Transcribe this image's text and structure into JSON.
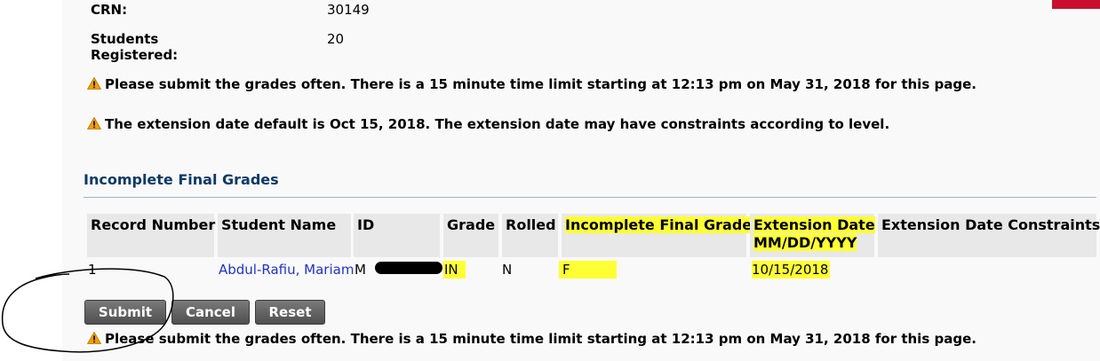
{
  "course_info": {
    "crn_label": "CRN:",
    "crn_value": "30149",
    "students_label": "Students Registered:",
    "students_value": "20"
  },
  "notices": {
    "time_limit": "Please submit the grades often. There is a 15 minute time limit starting at 12:13 pm on May 31, 2018 for this page.",
    "extension_default": "The extension date default is Oct 15, 2018. The extension date may have constraints according to level."
  },
  "section_title": "Incomplete Final Grades",
  "table": {
    "headers": {
      "record_number": "Record Number",
      "student_name": "Student Name",
      "id": "ID",
      "grade": "Grade",
      "rolled": "Rolled",
      "incomplete_final_grade": "Incomplete Final Grade",
      "extension_date": "Extension Date",
      "extension_date_format": "MM/DD/YYYY",
      "extension_constraints": "Extension Date Constraints"
    },
    "rows": [
      {
        "record_number": "1",
        "student_name": "Abdul-Rafiu, Mariam",
        "id": "M",
        "grade": "IN",
        "rolled": "N",
        "incomplete_final_grade": "F",
        "extension_date": "10/15/2018",
        "extension_constraints": ""
      }
    ]
  },
  "buttons": {
    "submit": "Submit",
    "cancel": "Cancel",
    "reset": "Reset"
  },
  "colors": {
    "highlight": "#ffff33",
    "section_title": "#0b3a68",
    "link": "#1f33cc",
    "warning": "#f0a000"
  }
}
